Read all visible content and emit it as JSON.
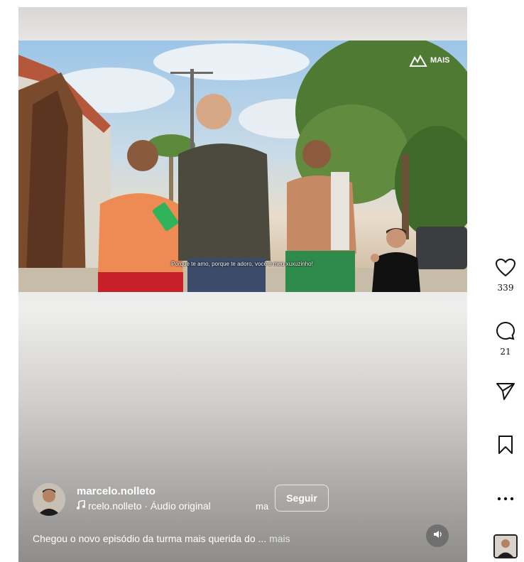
{
  "video": {
    "subtitle": "Porque te amo, porque te adoro, você é meu xuxuzinho!",
    "logo_text": "MAIS"
  },
  "author": {
    "username": "marcelo.nolleto",
    "audio_label": "rcelo.nolleto · Áudio original",
    "audio_overflow": "ma",
    "follow_label": "Seguir"
  },
  "caption": {
    "text": "Chegou o novo episódio da turma mais querida do ...",
    "more_label": "mais"
  },
  "actions": {
    "likes_count": "339",
    "comments_count": "21"
  },
  "icons": {
    "like": "heart-icon",
    "comment": "comment-icon",
    "share": "send-icon",
    "save": "bookmark-icon",
    "more": "more-icon",
    "music": "music-note-icon",
    "mute": "speaker-icon"
  }
}
